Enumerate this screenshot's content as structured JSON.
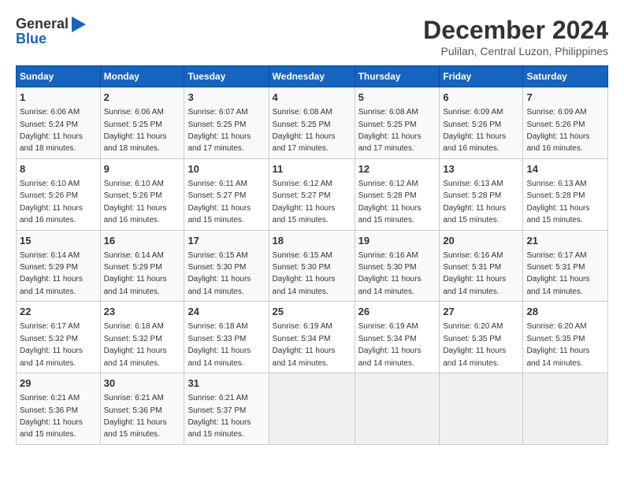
{
  "logo": {
    "line1": "General",
    "line2": "Blue"
  },
  "title": "December 2024",
  "subtitle": "Pulilan, Central Luzon, Philippines",
  "days_of_week": [
    "Sunday",
    "Monday",
    "Tuesday",
    "Wednesday",
    "Thursday",
    "Friday",
    "Saturday"
  ],
  "weeks": [
    [
      {
        "day": "1",
        "info": "Sunrise: 6:06 AM\nSunset: 5:24 PM\nDaylight: 11 hours\nand 18 minutes."
      },
      {
        "day": "2",
        "info": "Sunrise: 6:06 AM\nSunset: 5:25 PM\nDaylight: 11 hours\nand 18 minutes."
      },
      {
        "day": "3",
        "info": "Sunrise: 6:07 AM\nSunset: 5:25 PM\nDaylight: 11 hours\nand 17 minutes."
      },
      {
        "day": "4",
        "info": "Sunrise: 6:08 AM\nSunset: 5:25 PM\nDaylight: 11 hours\nand 17 minutes."
      },
      {
        "day": "5",
        "info": "Sunrise: 6:08 AM\nSunset: 5:25 PM\nDaylight: 11 hours\nand 17 minutes."
      },
      {
        "day": "6",
        "info": "Sunrise: 6:09 AM\nSunset: 5:26 PM\nDaylight: 11 hours\nand 16 minutes."
      },
      {
        "day": "7",
        "info": "Sunrise: 6:09 AM\nSunset: 5:26 PM\nDaylight: 11 hours\nand 16 minutes."
      }
    ],
    [
      {
        "day": "8",
        "info": "Sunrise: 6:10 AM\nSunset: 5:26 PM\nDaylight: 11 hours\nand 16 minutes."
      },
      {
        "day": "9",
        "info": "Sunrise: 6:10 AM\nSunset: 5:26 PM\nDaylight: 11 hours\nand 16 minutes."
      },
      {
        "day": "10",
        "info": "Sunrise: 6:11 AM\nSunset: 5:27 PM\nDaylight: 11 hours\nand 15 minutes."
      },
      {
        "day": "11",
        "info": "Sunrise: 6:12 AM\nSunset: 5:27 PM\nDaylight: 11 hours\nand 15 minutes."
      },
      {
        "day": "12",
        "info": "Sunrise: 6:12 AM\nSunset: 5:28 PM\nDaylight: 11 hours\nand 15 minutes."
      },
      {
        "day": "13",
        "info": "Sunrise: 6:13 AM\nSunset: 5:28 PM\nDaylight: 11 hours\nand 15 minutes."
      },
      {
        "day": "14",
        "info": "Sunrise: 6:13 AM\nSunset: 5:28 PM\nDaylight: 11 hours\nand 15 minutes."
      }
    ],
    [
      {
        "day": "15",
        "info": "Sunrise: 6:14 AM\nSunset: 5:29 PM\nDaylight: 11 hours\nand 14 minutes."
      },
      {
        "day": "16",
        "info": "Sunrise: 6:14 AM\nSunset: 5:29 PM\nDaylight: 11 hours\nand 14 minutes."
      },
      {
        "day": "17",
        "info": "Sunrise: 6:15 AM\nSunset: 5:30 PM\nDaylight: 11 hours\nand 14 minutes."
      },
      {
        "day": "18",
        "info": "Sunrise: 6:15 AM\nSunset: 5:30 PM\nDaylight: 11 hours\nand 14 minutes."
      },
      {
        "day": "19",
        "info": "Sunrise: 6:16 AM\nSunset: 5:30 PM\nDaylight: 11 hours\nand 14 minutes."
      },
      {
        "day": "20",
        "info": "Sunrise: 6:16 AM\nSunset: 5:31 PM\nDaylight: 11 hours\nand 14 minutes."
      },
      {
        "day": "21",
        "info": "Sunrise: 6:17 AM\nSunset: 5:31 PM\nDaylight: 11 hours\nand 14 minutes."
      }
    ],
    [
      {
        "day": "22",
        "info": "Sunrise: 6:17 AM\nSunset: 5:32 PM\nDaylight: 11 hours\nand 14 minutes."
      },
      {
        "day": "23",
        "info": "Sunrise: 6:18 AM\nSunset: 5:32 PM\nDaylight: 11 hours\nand 14 minutes."
      },
      {
        "day": "24",
        "info": "Sunrise: 6:18 AM\nSunset: 5:33 PM\nDaylight: 11 hours\nand 14 minutes."
      },
      {
        "day": "25",
        "info": "Sunrise: 6:19 AM\nSunset: 5:34 PM\nDaylight: 11 hours\nand 14 minutes."
      },
      {
        "day": "26",
        "info": "Sunrise: 6:19 AM\nSunset: 5:34 PM\nDaylight: 11 hours\nand 14 minutes."
      },
      {
        "day": "27",
        "info": "Sunrise: 6:20 AM\nSunset: 5:35 PM\nDaylight: 11 hours\nand 14 minutes."
      },
      {
        "day": "28",
        "info": "Sunrise: 6:20 AM\nSunset: 5:35 PM\nDaylight: 11 hours\nand 14 minutes."
      }
    ],
    [
      {
        "day": "29",
        "info": "Sunrise: 6:21 AM\nSunset: 5:36 PM\nDaylight: 11 hours\nand 15 minutes."
      },
      {
        "day": "30",
        "info": "Sunrise: 6:21 AM\nSunset: 5:36 PM\nDaylight: 11 hours\nand 15 minutes."
      },
      {
        "day": "31",
        "info": "Sunrise: 6:21 AM\nSunset: 5:37 PM\nDaylight: 11 hours\nand 15 minutes."
      },
      {
        "day": "",
        "info": ""
      },
      {
        "day": "",
        "info": ""
      },
      {
        "day": "",
        "info": ""
      },
      {
        "day": "",
        "info": ""
      }
    ]
  ]
}
